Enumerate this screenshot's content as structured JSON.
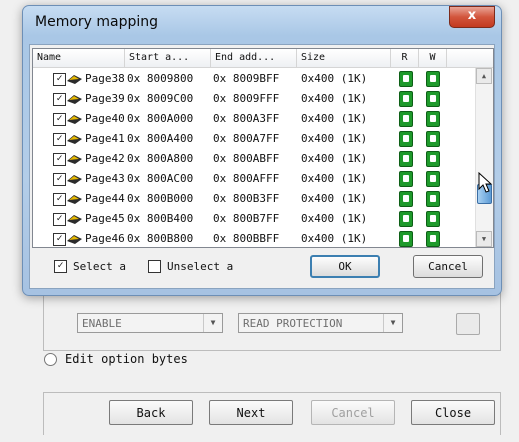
{
  "dialog": {
    "title": "Memory mapping",
    "close_label": "x",
    "columns": [
      "Name",
      "Start a...",
      "End add...",
      "Size",
      "R",
      "W"
    ],
    "rows": [
      {
        "name": "Page38",
        "start": "0x 8009800",
        "end": "0x 8009BFF",
        "size": "0x400  (1K)"
      },
      {
        "name": "Page39",
        "start": "0x 8009C00",
        "end": "0x 8009FFF",
        "size": "0x400  (1K)"
      },
      {
        "name": "Page40",
        "start": "0x 800A000",
        "end": "0x 800A3FF",
        "size": "0x400  (1K)"
      },
      {
        "name": "Page41",
        "start": "0x 800A400",
        "end": "0x 800A7FF",
        "size": "0x400  (1K)"
      },
      {
        "name": "Page42",
        "start": "0x 800A800",
        "end": "0x 800ABFF",
        "size": "0x400  (1K)"
      },
      {
        "name": "Page43",
        "start": "0x 800AC00",
        "end": "0x 800AFFF",
        "size": "0x400  (1K)"
      },
      {
        "name": "Page44",
        "start": "0x 800B000",
        "end": "0x 800B3FF",
        "size": "0x400  (1K)"
      },
      {
        "name": "Page45",
        "start": "0x 800B400",
        "end": "0x 800B7FF",
        "size": "0x400  (1K)"
      },
      {
        "name": "Page46",
        "start": "0x 800B800",
        "end": "0x 800BBFF",
        "size": "0x400  (1K)"
      }
    ],
    "select_all_label": "Select a",
    "unselect_all_label": "Unselect a",
    "ok_label": "OK",
    "cancel_label": "Cancel",
    "lock_color": "#1e9a2b"
  },
  "wizard": {
    "combo1_value": "ENABLE",
    "combo2_value": "READ PROTECTION",
    "edit_option_label": "Edit option bytes",
    "back_label": "Back",
    "next_label": "Next",
    "cancel_label": "Cancel",
    "close_label": "Close"
  }
}
